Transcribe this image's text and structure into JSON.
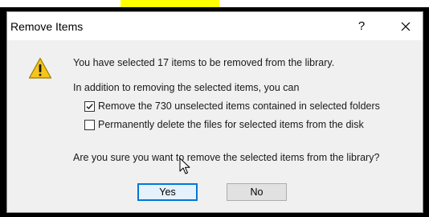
{
  "dialog": {
    "title": "Remove Items",
    "help_label": "?",
    "close_icon": "close-icon"
  },
  "message": {
    "line1": "You have selected 17 items to be removed from the library.",
    "line2": "In addition to removing the selected items, you can",
    "question": "Are you sure you want to remove the selected items from the library?"
  },
  "options": [
    {
      "label": "Remove the 730 unselected items contained in selected folders",
      "checked": true
    },
    {
      "label": "Permanently delete the files for selected items from the disk",
      "checked": false
    }
  ],
  "buttons": {
    "yes_label": "Yes",
    "no_label": "No"
  },
  "icons": {
    "warning": "warning-icon",
    "cursor": "mouse-cursor-icon"
  },
  "colors": {
    "highlight": "#ffff00",
    "frame": "#000000",
    "dialog_bg": "#f0f0f0",
    "accent": "#0078d7",
    "warning_fill": "#f5c518"
  }
}
